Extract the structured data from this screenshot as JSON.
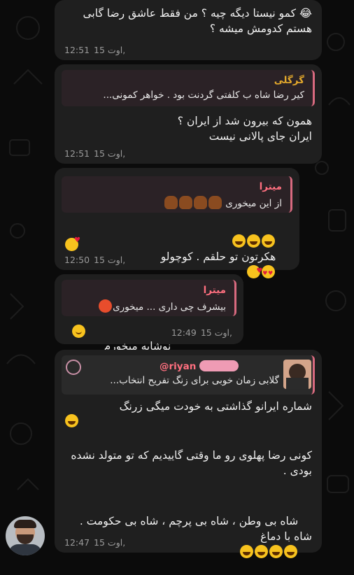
{
  "messages": [
    {
      "text": "😂 کمو نیستا دیگه چیه ؟ من فقط عاشق رضا گابی هستم کدومش میشه ؟",
      "date": "15 اوت,",
      "time": "12:51"
    },
    {
      "reply_name": "گرگلی",
      "reply_text": "کیر رضا شاه ب کلفتی گردنت بود .  خواهر کمونی...",
      "text": "همون که بیرون شد از ایران ؟\nایران جای پالانی نیست",
      "date": "15 اوت,",
      "time": "12:51"
    },
    {
      "reply_name": "میترا",
      "reply_text": "از این میخوری",
      "text": "هکرتون تو حلقم . کوچولو",
      "date": "15 اوت,",
      "time": "12:50"
    },
    {
      "reply_name": "میترا",
      "reply_text": "بیشرف چی داری ... میخوری",
      "text": "نوشابه میخورم",
      "date": "15 اوت,",
      "time": "12:49"
    },
    {
      "reply_name": "@riyan",
      "reply_text": "گلابی زمان خوبی برای زنگ تفریح انتخاب...",
      "text_1": "شماره ایرانو گذاشتی به خودت میگی زرنگ",
      "text_2": "کونی رضا پهلوی رو ما وقتی گاییدیم که تو متولد نشده بودی .",
      "text_3": "شاه بی وطن ، شاه بی پرچم ، شاه بی حکومت . شاه با دماغ",
      "date": "15 اوت,",
      "time": "12:47"
    }
  ],
  "colors": {
    "background": "#0b0b0b",
    "bubble": "#1f1f1f",
    "reply_accent": "#d86a7f",
    "name_pink": "#ff6f7f",
    "name_gold": "#e3a82c"
  }
}
